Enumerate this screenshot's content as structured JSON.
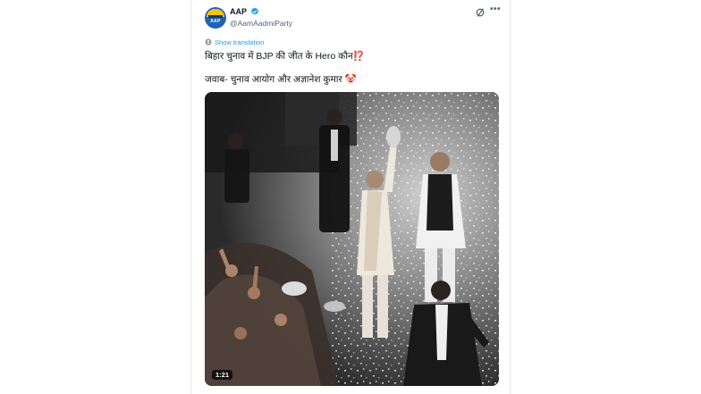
{
  "account": {
    "display_name": "AAP",
    "handle": "@AamAadmiParty",
    "avatar_text": "AAP"
  },
  "tweet": {
    "translate_label": "Show translation",
    "line1_pre": "बिहार चुनाव में BJP की जीत के Hero कौन",
    "line1_emoji": "⁉️",
    "line2": "जवाब- चुनाव आयोग और अज्ञानेश कुमार 🤡"
  },
  "video": {
    "duration": "1:21"
  },
  "icons": {
    "verified": "verified-badge-icon",
    "grok": "grok-icon",
    "more": "more-options-icon",
    "translate": "globe-icon"
  },
  "colors": {
    "link": "#1d9bf0",
    "verified": "#1d9bf0",
    "text": "#0f1419",
    "secondary": "#536471"
  }
}
